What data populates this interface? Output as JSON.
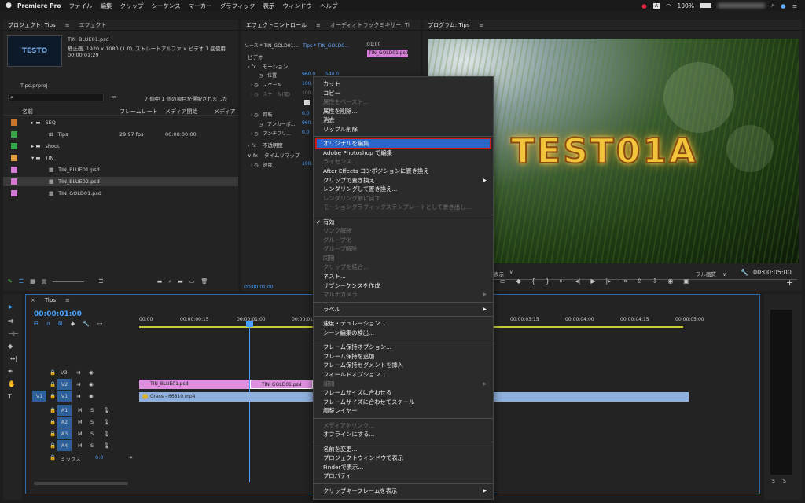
{
  "menubar": {
    "apple": "",
    "app": "Premiere Pro",
    "items": [
      "ファイル",
      "編集",
      "クリップ",
      "シーケンス",
      "マーカー",
      "グラフィック",
      "表示",
      "ウィンドウ",
      "ヘルプ"
    ],
    "battery": "100%",
    "input_method": "A"
  },
  "project_panel": {
    "title": "プロジェクト: Tips",
    "tab2": "エフェクト",
    "preview_label": "TESTO",
    "file_name": "TIN_BLUE01.psd",
    "file_info": "静止画, 1920 x 1080 (1.0), ストレートアルファ ∨ ビデオ 1 回使用",
    "file_duration": "00;00;01;29",
    "project_file": "Tips.prproj",
    "search_placeholder": "",
    "selection_info": "7 個中 1 個の項目が選択されました",
    "columns": [
      "名前",
      "フレームレート",
      "メディア開始",
      "メディア"
    ],
    "items": [
      {
        "name": "SEQ",
        "color": "#c8742a",
        "indent": 1,
        "type": "folder",
        "fps": "",
        "start": ""
      },
      {
        "name": "Tips",
        "color": "#3aa64a",
        "indent": 2,
        "type": "seq",
        "fps": "29.97 fps",
        "start": "00:00:00:00"
      },
      {
        "name": "shoot",
        "color": "#3aa64a",
        "indent": 1,
        "type": "folder",
        "fps": "",
        "start": ""
      },
      {
        "name": "TIN",
        "color": "#e0a040",
        "indent": 1,
        "type": "folder",
        "fps": "",
        "start": ""
      },
      {
        "name": "TIN_BLUE01.psd",
        "color": "#d27ad2",
        "indent": 2,
        "type": "file",
        "fps": "",
        "start": ""
      },
      {
        "name": "TIN_BLUE02.psd",
        "color": "#d27ad2",
        "indent": 2,
        "type": "file",
        "fps": "",
        "start": ""
      },
      {
        "name": "TIN_GOLD01.psd",
        "color": "#d27ad2",
        "indent": 2,
        "type": "file",
        "fps": "",
        "start": ""
      }
    ]
  },
  "effect_controls": {
    "title": "エフェクトコントロール",
    "tab2": "オーディオトラックミキサー: Ti",
    "source": "ソース * TIN_GOLD01...",
    "seq": "Tips * TIN_GOLD0...",
    "clip_label": "TIN_GOLD01.psd",
    "time_label": ":01:00",
    "video_label": "ビデオ",
    "motion": "モーション",
    "position": "位置",
    "pos_x": "960.0",
    "pos_y": "540.0",
    "scale": "スケール",
    "scale_val": "100.0",
    "scale_w": "スケール(幅)",
    "scale_w_val": "100.0",
    "rotate": "回転",
    "rotate_val": "0.0",
    "anchor": "アンカーポ...",
    "anchor_val": "960.0",
    "antiflicker": "アンチフリ...",
    "antiflicker_val": "0.0",
    "opacity": "不透明度",
    "remap": "タイムリマップ",
    "speed": "速度",
    "speed_val": "100.0",
    "timecode": "00:00:01:00"
  },
  "program_monitor": {
    "title": "プログラム: Tips",
    "overlay_text": "TEST01A",
    "display_label": "表示",
    "quality": "フル画質",
    "timecode": "00:00:05:00"
  },
  "timeline": {
    "tab": "Tips",
    "timecode": "00:00:01:00",
    "ruler": [
      "00:00",
      "00:00:00:15",
      "00:00:01:00",
      "00:00:01:15",
      "00:00:03:15",
      "00:00:04:00",
      "00:00:04:15",
      "00:00:05:00"
    ],
    "tracks": [
      {
        "name": "V3",
        "type": "video"
      },
      {
        "name": "V2",
        "type": "video"
      },
      {
        "name": "V1",
        "type": "video",
        "src": "V1"
      },
      {
        "name": "A1",
        "type": "audio"
      },
      {
        "name": "A2",
        "type": "audio"
      },
      {
        "name": "A3",
        "type": "audio"
      },
      {
        "name": "A4",
        "type": "audio"
      }
    ],
    "mix_label": "ミックス",
    "mix_val": "0.0",
    "clips": {
      "v2a": "TIN_BLUE01.psd",
      "v2b": "TIN_GOLD01.psd",
      "v1": "Grass - 66810.mp4"
    }
  },
  "context_menu": {
    "items": [
      {
        "label": "カット",
        "enabled": true
      },
      {
        "label": "コピー",
        "enabled": true
      },
      {
        "label": "属性をペースト...",
        "enabled": false
      },
      {
        "label": "属性を削除...",
        "enabled": true
      },
      {
        "label": "消去",
        "enabled": true
      },
      {
        "label": "リップル削除",
        "enabled": true
      },
      {
        "sep": true
      },
      {
        "label": "オリジナルを編集",
        "enabled": true,
        "highlight": true
      },
      {
        "label": "Adobe Photoshop で編集",
        "enabled": true
      },
      {
        "label": "ライセンス...",
        "enabled": false
      },
      {
        "label": "After Effects コンポジションに置き換え",
        "enabled": true
      },
      {
        "label": "クリップで置き換え",
        "enabled": true,
        "submenu": true
      },
      {
        "label": "レンダリングして置き換え...",
        "enabled": true
      },
      {
        "label": "レンダリング前に戻す",
        "enabled": false
      },
      {
        "label": "モーショングラフィックステンプレートとして書き出し...",
        "enabled": false
      },
      {
        "sep": true
      },
      {
        "label": "有効",
        "enabled": true,
        "checked": true
      },
      {
        "label": "リンク解除",
        "enabled": false
      },
      {
        "label": "グループ化",
        "enabled": false
      },
      {
        "label": "グループ解除",
        "enabled": false
      },
      {
        "label": "同期",
        "enabled": false
      },
      {
        "label": "クリップを結合...",
        "enabled": false
      },
      {
        "label": "ネスト...",
        "enabled": true
      },
      {
        "label": "サブシーケンスを作成",
        "enabled": true
      },
      {
        "label": "マルチカメラ",
        "enabled": false,
        "submenu": true
      },
      {
        "sep": true
      },
      {
        "label": "ラベル",
        "enabled": true,
        "submenu": true
      },
      {
        "sep": true
      },
      {
        "label": "速度・デュレーション...",
        "enabled": true
      },
      {
        "label": "シーン編集の検出...",
        "enabled": true
      },
      {
        "sep": true
      },
      {
        "label": "フレーム保持オプション...",
        "enabled": true
      },
      {
        "label": "フレーム保持を追加",
        "enabled": true
      },
      {
        "label": "フレーム保持セグメントを挿入",
        "enabled": true
      },
      {
        "label": "フィールドオプション...",
        "enabled": true
      },
      {
        "label": "補間",
        "enabled": false,
        "submenu": true
      },
      {
        "label": "フレームサイズに合わせる",
        "enabled": true
      },
      {
        "label": "フレームサイズに合わせてスケール",
        "enabled": true
      },
      {
        "label": "調整レイヤー",
        "enabled": true
      },
      {
        "sep": true
      },
      {
        "label": "メディアをリンク...",
        "enabled": false
      },
      {
        "label": "オフラインにする...",
        "enabled": true
      },
      {
        "sep": true
      },
      {
        "label": "名前を変更...",
        "enabled": true
      },
      {
        "label": "プロジェクトウィンドウで表示",
        "enabled": true
      },
      {
        "label": "Finderで表示...",
        "enabled": true
      },
      {
        "label": "プロパティ",
        "enabled": true
      },
      {
        "sep": true
      },
      {
        "label": "クリップキーフレームを表示",
        "enabled": true,
        "submenu": true
      }
    ]
  }
}
